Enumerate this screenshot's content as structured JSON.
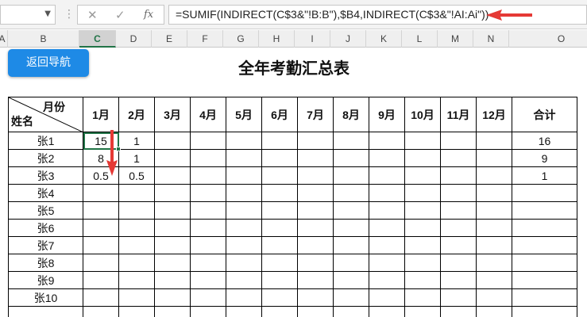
{
  "formula_bar": {
    "name_box": "",
    "cancel_icon": "close-icon",
    "confirm_icon": "check-icon",
    "fx_label": "fx",
    "formula": "=SUMIF(INDIRECT(C$3&\"!B:B\"),$B4,INDIRECT(C$3&\"!AI:Ai\"))"
  },
  "columns": [
    "A",
    "B",
    "C",
    "D",
    "E",
    "F",
    "G",
    "H",
    "I",
    "J",
    "K",
    "L",
    "M",
    "N",
    "O"
  ],
  "selected_column": "C",
  "nav_button": "返回导航",
  "title": "全年考勤汇总表",
  "table": {
    "corner_month": "月份",
    "corner_name": "姓名",
    "months": [
      "1月",
      "2月",
      "3月",
      "4月",
      "5月",
      "6月",
      "7月",
      "8月",
      "9月",
      "10月",
      "11月",
      "12月"
    ],
    "total_header": "合计",
    "rows": [
      {
        "name": "张1",
        "values": [
          "15",
          "1",
          "",
          "",
          "",
          "",
          "",
          "",
          "",
          "",
          "",
          ""
        ],
        "total": "16"
      },
      {
        "name": "张2",
        "values": [
          "8",
          "1",
          "",
          "",
          "",
          "",
          "",
          "",
          "",
          "",
          "",
          ""
        ],
        "total": "9"
      },
      {
        "name": "张3",
        "values": [
          "0.5",
          "0.5",
          "",
          "",
          "",
          "",
          "",
          "",
          "",
          "",
          "",
          ""
        ],
        "total": "1"
      },
      {
        "name": "张4",
        "values": [
          "",
          "",
          "",
          "",
          "",
          "",
          "",
          "",
          "",
          "",
          "",
          ""
        ],
        "total": ""
      },
      {
        "name": "张5",
        "values": [
          "",
          "",
          "",
          "",
          "",
          "",
          "",
          "",
          "",
          "",
          "",
          ""
        ],
        "total": ""
      },
      {
        "name": "张6",
        "values": [
          "",
          "",
          "",
          "",
          "",
          "",
          "",
          "",
          "",
          "",
          "",
          ""
        ],
        "total": ""
      },
      {
        "name": "张7",
        "values": [
          "",
          "",
          "",
          "",
          "",
          "",
          "",
          "",
          "",
          "",
          "",
          ""
        ],
        "total": ""
      },
      {
        "name": "张8",
        "values": [
          "",
          "",
          "",
          "",
          "",
          "",
          "",
          "",
          "",
          "",
          "",
          ""
        ],
        "total": ""
      },
      {
        "name": "张9",
        "values": [
          "",
          "",
          "",
          "",
          "",
          "",
          "",
          "",
          "",
          "",
          "",
          ""
        ],
        "total": ""
      },
      {
        "name": "张10",
        "values": [
          "",
          "",
          "",
          "",
          "",
          "",
          "",
          "",
          "",
          "",
          "",
          ""
        ],
        "total": ""
      },
      {
        "name": "",
        "values": [
          "",
          "",
          "",
          "",
          "",
          "",
          "",
          "",
          "",
          "",
          "",
          ""
        ],
        "total": ""
      }
    ]
  },
  "colors": {
    "accent_green": "#217346",
    "nav_button_blue": "#1e8ae6",
    "annotation_red": "#e53935"
  }
}
